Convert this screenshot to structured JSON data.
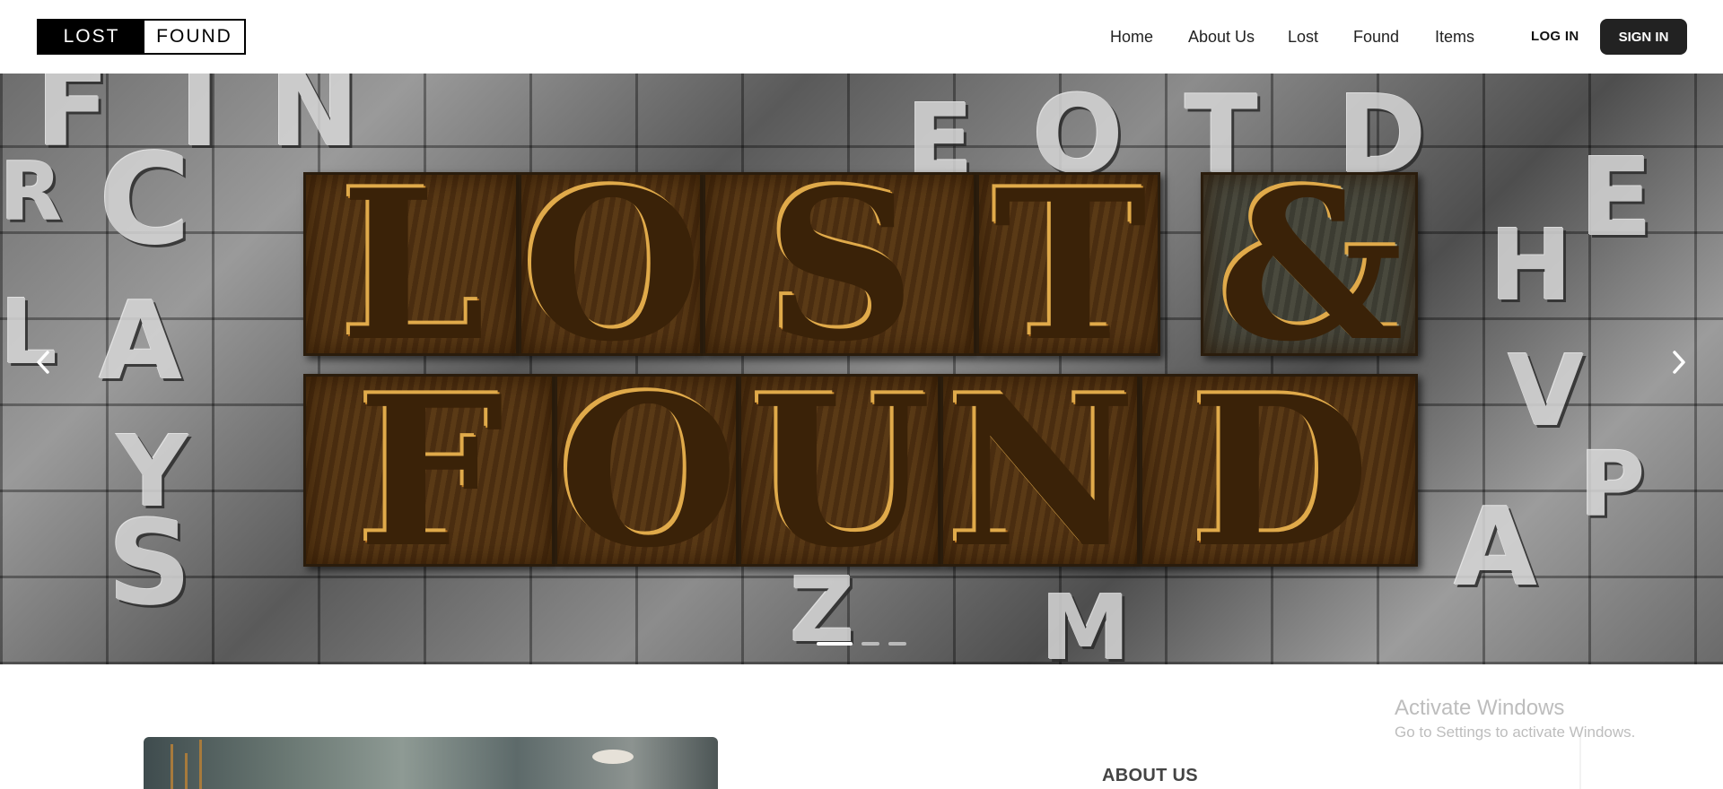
{
  "brand": {
    "lost": "LOST",
    "found": "FOUND"
  },
  "nav": {
    "home": "Home",
    "about": "About Us",
    "lost": "Lost",
    "found": "Found",
    "items": "Items"
  },
  "auth": {
    "login": "LOG IN",
    "signin": "SIGN IN"
  },
  "hero": {
    "line1": [
      "L",
      "O",
      "S",
      "T",
      "&"
    ],
    "line2": [
      "F",
      "O",
      "U",
      "N",
      "D"
    ],
    "background_letters": [
      "F",
      "I",
      "N",
      "E",
      "O",
      "T",
      "D",
      "R",
      "C",
      "A",
      "L",
      "Y",
      "E",
      "H",
      "V",
      "A",
      "P",
      "S",
      "M",
      "Z"
    ],
    "slides_total": 3,
    "active_slide": 1,
    "prev_icon": "chevron-left-icon",
    "next_icon": "chevron-right-icon"
  },
  "about": {
    "title": "ABOUT US"
  },
  "watermark": {
    "title": "Activate Windows",
    "subtitle": "Go to Settings to activate Windows."
  },
  "colors": {
    "button_dark": "#222222",
    "wood": "#c88a23",
    "metal": "#9a9a9a"
  }
}
